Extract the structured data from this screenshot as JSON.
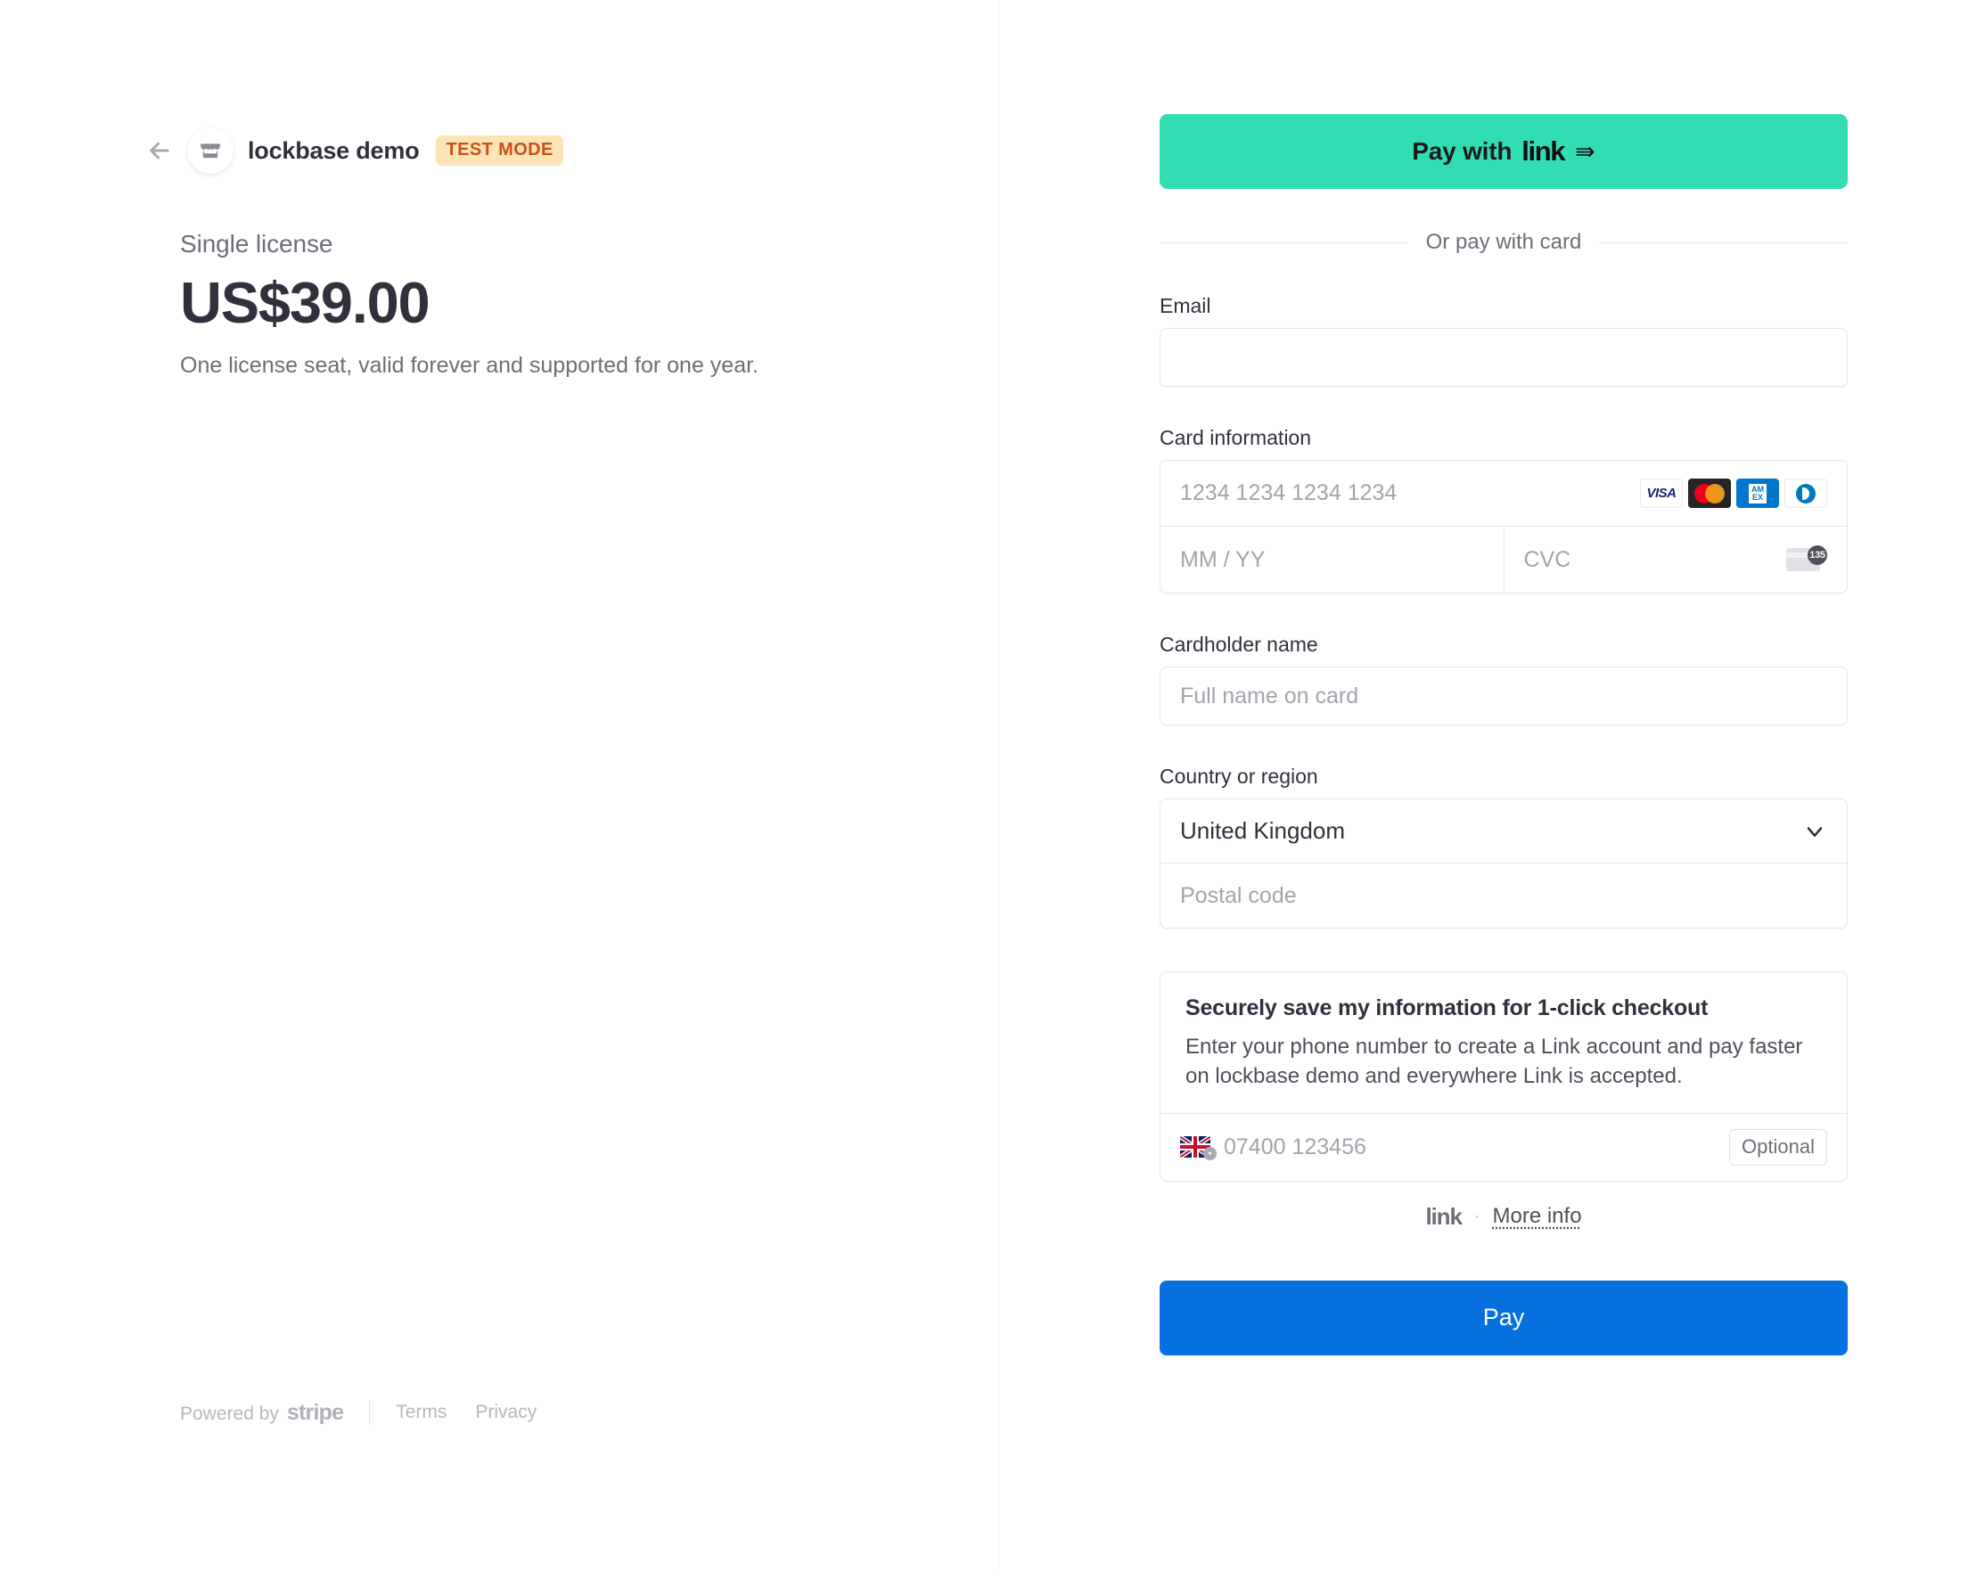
{
  "merchant": {
    "back_icon": "arrow-left-icon",
    "logo_icon": "storefront-icon",
    "name": "lockbase demo",
    "badge": "TEST MODE"
  },
  "product": {
    "name": "Single license",
    "price": "US$39.00",
    "description": "One license seat, valid forever and supported for one year."
  },
  "left_footer": {
    "powered_by": "Powered by",
    "stripe": "stripe",
    "terms": "Terms",
    "privacy": "Privacy"
  },
  "payment": {
    "link_button": {
      "label": "Pay with",
      "logo": "link",
      "arrow": "⇛"
    },
    "divider_text": "Or pay with card",
    "email": {
      "label": "Email",
      "value": "",
      "placeholder": ""
    },
    "card": {
      "label": "Card information",
      "number_placeholder": "1234 1234 1234 1234",
      "expiry_placeholder": "MM / YY",
      "cvc_placeholder": "CVC",
      "cvc_hint_digits": "135",
      "brands": [
        {
          "name": "visa",
          "text": "VISA"
        },
        {
          "name": "mastercard",
          "text": ""
        },
        {
          "name": "amex",
          "line1": "AM",
          "line2": "EX"
        },
        {
          "name": "diners",
          "text": ""
        }
      ]
    },
    "cardholder": {
      "label": "Cardholder name",
      "placeholder": "Full name on card",
      "value": ""
    },
    "country": {
      "label": "Country or region",
      "selected": "United Kingdom",
      "postal_placeholder": "Postal code",
      "postal_value": "",
      "chevron_icon": "chevron-down-icon"
    },
    "link_save": {
      "title": "Securely save my information for 1-click checkout",
      "description": "Enter your phone number to create a Link account and pay faster on lockbase demo and everywhere Link is accepted.",
      "flag": "uk-flag-icon",
      "phone_placeholder": "07400 123456",
      "phone_value": "",
      "optional_badge": "Optional",
      "footer_logo": "link",
      "footer_dot": "·",
      "footer_link": "More info"
    },
    "submit_label": "Pay"
  },
  "colors": {
    "link_green": "#33ddb3",
    "pay_blue": "#0570de",
    "test_badge_bg": "#fce4b6",
    "test_badge_text": "#c4531a",
    "text_primary": "#30313d",
    "text_secondary": "#6d6e78",
    "border": "#e6e6eb"
  }
}
